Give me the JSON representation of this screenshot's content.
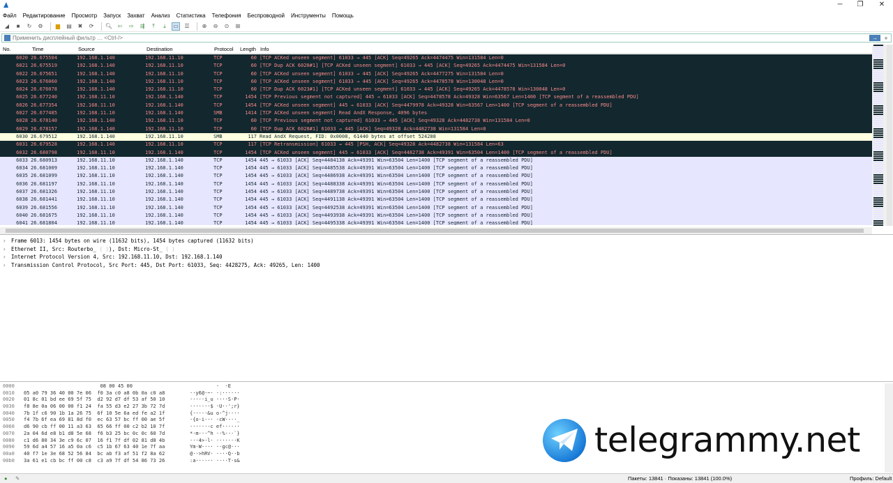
{
  "window": {
    "minimize": "─",
    "maximize": "❐",
    "close": "✕"
  },
  "menu": [
    "Файл",
    "Редактирование",
    "Просмотр",
    "Запуск",
    "Захват",
    "Анализ",
    "Статистика",
    "Телефония",
    "Беспроводной",
    "Инструменты",
    "Помощь"
  ],
  "filter": {
    "placeholder": "Применить дисплейный фильтр … <Ctrl-/>"
  },
  "columns": {
    "no": "No.",
    "time": "Time",
    "source": "Source",
    "destination": "Destination",
    "protocol": "Protocol",
    "length": "Length",
    "info": "Info"
  },
  "packets": [
    {
      "no": "6020",
      "time": "26.675504",
      "src": "192.168.1.140",
      "dst": "192.168.11.10",
      "proto": "TCP",
      "len": "60",
      "info": "[TCP ACKed unseen segment] 61033 → 445 [ACK] Seq=49265 Ack=4474475 Win=131584 Len=0",
      "style": "dark"
    },
    {
      "no": "6021",
      "time": "26.675519",
      "src": "192.168.1.140",
      "dst": "192.168.11.10",
      "proto": "TCP",
      "len": "60",
      "info": "[TCP Dup ACK 6020#1] [TCP ACKed unseen segment] 61033 → 445 [ACK] Seq=49265 Ack=4474475 Win=131584 Len=0",
      "style": "dark"
    },
    {
      "no": "6022",
      "time": "26.675651",
      "src": "192.168.1.140",
      "dst": "192.168.11.10",
      "proto": "TCP",
      "len": "60",
      "info": "[TCP ACKed unseen segment] 61033 → 445 [ACK] Seq=49265 Ack=4477275 Win=131584 Len=0",
      "style": "dark"
    },
    {
      "no": "6023",
      "time": "26.676060",
      "src": "192.168.1.140",
      "dst": "192.168.11.10",
      "proto": "TCP",
      "len": "60",
      "info": "[TCP ACKed unseen segment] 61033 → 445 [ACK] Seq=49265 Ack=4478578 Win=130048 Len=0",
      "style": "dark"
    },
    {
      "no": "6024",
      "time": "26.676078",
      "src": "192.168.1.140",
      "dst": "192.168.11.10",
      "proto": "TCP",
      "len": "60",
      "info": "[TCP Dup ACK 6023#1] [TCP ACKed unseen segment] 61033 → 445 [ACK] Seq=49265 Ack=4478578 Win=130048 Len=0",
      "style": "dark"
    },
    {
      "no": "6025",
      "time": "26.677240",
      "src": "192.168.11.10",
      "dst": "192.168.1.140",
      "proto": "TCP",
      "len": "1454",
      "info": "[TCP Previous segment not captured] 445 → 61033 [ACK] Seq=4478578 Ack=49328 Win=63567 Len=1400 [TCP segment of a reassembled PDU]",
      "style": "dark"
    },
    {
      "no": "6026",
      "time": "26.677354",
      "src": "192.168.11.10",
      "dst": "192.168.1.140",
      "proto": "TCP",
      "len": "1454",
      "info": "[TCP ACKed unseen segment] 445 → 61033 [ACK] Seq=4479978 Ack=49328 Win=63567 Len=1400 [TCP segment of a reassembled PDU]",
      "style": "dark"
    },
    {
      "no": "6027",
      "time": "26.677485",
      "src": "192.168.11.10",
      "dst": "192.168.1.140",
      "proto": "SMB",
      "len": "1414",
      "info": "[TCP ACKed unseen segment] Read AndX Response, 4096 bytes",
      "style": "dark"
    },
    {
      "no": "6028",
      "time": "26.678140",
      "src": "192.168.1.140",
      "dst": "192.168.11.10",
      "proto": "TCP",
      "len": "60",
      "info": "[TCP Previous segment not captured] 61033 → 445 [ACK] Seq=49328 Ack=4482738 Win=131584 Len=0",
      "style": "dark"
    },
    {
      "no": "6029",
      "time": "26.678157",
      "src": "192.168.1.140",
      "dst": "192.168.11.10",
      "proto": "TCP",
      "len": "60",
      "info": "[TCP Dup ACK 6028#1] 61033 → 445 [ACK] Seq=49328 Ack=4482738 Win=131584 Len=0",
      "style": "dark"
    },
    {
      "no": "6030",
      "time": "26.679512",
      "src": "192.168.1.140",
      "dst": "192.168.11.10",
      "proto": "SMB",
      "len": "117",
      "info": "Read AndX Request, FID: 0x0008, 61440 bytes at offset 524288",
      "style": "sel"
    },
    {
      "no": "6031",
      "time": "26.679528",
      "src": "192.168.1.140",
      "dst": "192.168.11.10",
      "proto": "TCP",
      "len": "117",
      "info": "[TCP Retransmission] 61033 → 445 [PSH, ACK] Seq=49328 Ack=4482738 Win=131584 Len=63",
      "style": "dark"
    },
    {
      "no": "6032",
      "time": "26.680798",
      "src": "192.168.11.10",
      "dst": "192.168.1.140",
      "proto": "TCP",
      "len": "1454",
      "info": "[TCP ACKed unseen segment] 445 → 61033 [ACK] Seq=4482738 Ack=49391 Win=63504 Len=1400 [TCP segment of a reassembled PDU]",
      "style": "dark"
    },
    {
      "no": "6033",
      "time": "26.680913",
      "src": "192.168.11.10",
      "dst": "192.168.1.140",
      "proto": "TCP",
      "len": "1454",
      "info": "445 → 61033 [ACK] Seq=4484138 Ack=49391 Win=63504 Len=1400 [TCP segment of a reassembled PDU]",
      "style": "blue"
    },
    {
      "no": "6034",
      "time": "26.681009",
      "src": "192.168.11.10",
      "dst": "192.168.1.140",
      "proto": "TCP",
      "len": "1454",
      "info": "445 → 61033 [ACK] Seq=4485538 Ack=49391 Win=63504 Len=1400 [TCP segment of a reassembled PDU]",
      "style": "blue"
    },
    {
      "no": "6035",
      "time": "26.681099",
      "src": "192.168.11.10",
      "dst": "192.168.1.140",
      "proto": "TCP",
      "len": "1454",
      "info": "445 → 61033 [ACK] Seq=4486938 Ack=49391 Win=63504 Len=1400 [TCP segment of a reassembled PDU]",
      "style": "blue"
    },
    {
      "no": "6036",
      "time": "26.681197",
      "src": "192.168.11.10",
      "dst": "192.168.1.140",
      "proto": "TCP",
      "len": "1454",
      "info": "445 → 61033 [ACK] Seq=4488338 Ack=49391 Win=63504 Len=1400 [TCP segment of a reassembled PDU]",
      "style": "blue"
    },
    {
      "no": "6037",
      "time": "26.681326",
      "src": "192.168.11.10",
      "dst": "192.168.1.140",
      "proto": "TCP",
      "len": "1454",
      "info": "445 → 61033 [ACK] Seq=4489738 Ack=49391 Win=63504 Len=1400 [TCP segment of a reassembled PDU]",
      "style": "blue"
    },
    {
      "no": "6038",
      "time": "26.681441",
      "src": "192.168.11.10",
      "dst": "192.168.1.140",
      "proto": "TCP",
      "len": "1454",
      "info": "445 → 61033 [ACK] Seq=4491138 Ack=49391 Win=63504 Len=1400 [TCP segment of a reassembled PDU]",
      "style": "blue"
    },
    {
      "no": "6039",
      "time": "26.681556",
      "src": "192.168.11.10",
      "dst": "192.168.1.140",
      "proto": "TCP",
      "len": "1454",
      "info": "445 → 61033 [ACK] Seq=4492538 Ack=49391 Win=63504 Len=1400 [TCP segment of a reassembled PDU]",
      "style": "blue"
    },
    {
      "no": "6040",
      "time": "26.681675",
      "src": "192.168.11.10",
      "dst": "192.168.1.140",
      "proto": "TCP",
      "len": "1454",
      "info": "445 → 61033 [ACK] Seq=4493938 Ack=49391 Win=63504 Len=1400 [TCP segment of a reassembled PDU]",
      "style": "blue"
    },
    {
      "no": "6041",
      "time": "26.681804",
      "src": "192.168.11.10",
      "dst": "192.168.1.140",
      "proto": "TCP",
      "len": "1454",
      "info": "445 → 61033 [ACK] Seq=4495338 Ack=49391 Win=63504 Len=1400 [TCP segment of a reassembled PDU]",
      "style": "blue"
    }
  ],
  "details": [
    "Frame 6013: 1454 bytes on wire (11632 bits), 1454 bytes captured (11632 bits)",
    "Ethernet II, Src: Routerbo_",
    "Internet Protocol Version 4, Src: 192.168.11.10, Dst: 192.168.1.140",
    "Transmission Control Protocol, Src Port: 445, Dst Port: 61033, Seq: 4428275, Ack: 49265, Len: 1400"
  ],
  "details_eth_dst": "), Dst: Micro-St_",
  "bytes": [
    {
      "off": "0000",
      "hex": "                          08 00 45 00",
      "asc": "         ·  ·E"
    },
    {
      "off": "0010",
      "hex": "05 a0 79 36 40 00 7e 06  f0 3a c0 a8 0b 0a c0 a8",
      "asc": "··y6@·~· ·:······"
    },
    {
      "off": "0020",
      "hex": "01 8c 01 bd ee 69 5f 75  d2 92 d7 df 53 af 50 10",
      "asc": "·····i_u ····S·P·"
    },
    {
      "off": "0030",
      "hex": "f8 8e 0a 06 00 00 f1 24  fa 55 d3 e2 27 3b 72 7d",
      "asc": "·······$ ·U··';r}"
    },
    {
      "off": "0040",
      "hex": "7b 1f c6 90 1b 1a 26 75  6f 10 5e 6a ed fe a2 1f",
      "asc": "{·····&u o·^j····"
    },
    {
      "off": "0050",
      "hex": "f4 7b 6f ea 69 81 8d f0  ec 63 57 bc ff 00 ae 5f",
      "asc": "·{o·i··· ·cW····_"
    },
    {
      "off": "0060",
      "hex": "d6 90 cb ff 00 11 a3 63  65 66 ff 00 c2 b2 10 7f",
      "asc": "·······c ef······"
    },
    {
      "off": "0070",
      "hex": "2a 04 6d e8 b1 d8 5e 68  f6 b3 25 bc 0c 0c 60 7d",
      "asc": "*·m···^h ··%···`}"
    },
    {
      "off": "0080",
      "hex": "c1 d6 80 34 3e c9 6c 07  16 f1 7f df 02 81 d8 4b",
      "asc": "···4>·l· ·······K"
    },
    {
      "off": "0090",
      "hex": "59 6d a4 57 16 a5 0a c6  c5 1b 67 63 40 1e 7f aa",
      "asc": "Ym·W···· ··gc@···"
    },
    {
      "off": "00a0",
      "hex": "40 f7 1e 3e 68 52 56 84  bc ab f3 af 51 f2 8a 62",
      "asc": "@··>hRV· ····Q··b"
    },
    {
      "off": "00b0",
      "hex": "3a 61 e1 cb bc ff 00 c8  c3 a9 7f df 54 86 73 26",
      "asc": ":a······ ····T·s&"
    }
  ],
  "watermark": "telegrammy.net",
  "status": {
    "packets": "Пакеты: 13841 · Показаны: 13841 (100.0%)",
    "profile": "Профиль: Default"
  },
  "colors": {
    "dark_row_bg": "#12272e",
    "dark_row_fg": "#f78b8b",
    "blue_row_bg": "#e7e6ff",
    "selected_row_bg": "#ffffe1"
  }
}
